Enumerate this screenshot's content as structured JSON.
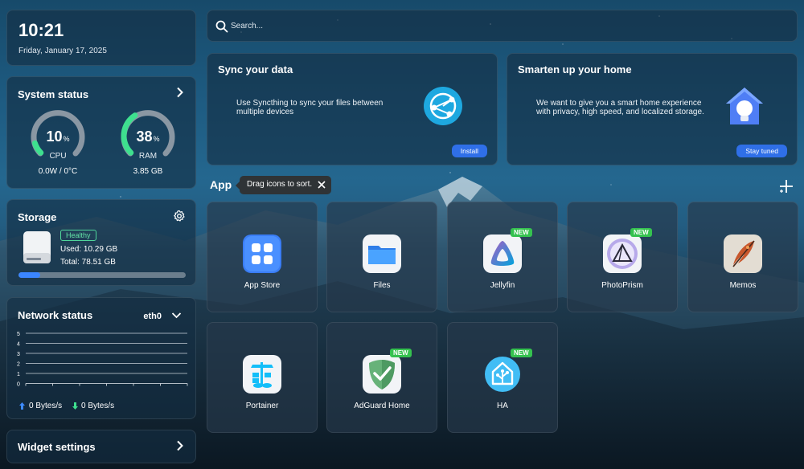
{
  "clock": {
    "time": "10:21",
    "date": "Friday, January 17, 2025"
  },
  "system_status": {
    "title": "System status",
    "cpu": {
      "value": "10",
      "unit": "%",
      "label": "CPU",
      "sub": "0.0W / 0°C",
      "percent": 10
    },
    "ram": {
      "value": "38",
      "unit": "%",
      "label": "RAM",
      "sub": "3.85 GB",
      "percent": 38
    }
  },
  "storage": {
    "title": "Storage",
    "health": "Healthy",
    "used": "Used: 10.29 GB",
    "total": "Total: 78.51 GB",
    "fraction_used": 0.131
  },
  "network": {
    "title": "Network status",
    "interface": "eth0",
    "y_ticks": [
      "5",
      "4",
      "3",
      "2",
      "1",
      "0"
    ],
    "upload": "0 Bytes/s",
    "download": "0 Bytes/s"
  },
  "widget_settings": {
    "label": "Widget settings"
  },
  "search": {
    "placeholder": "Search..."
  },
  "promos": {
    "sync": {
      "title": "Sync your data",
      "description": "Use Syncthing to sync your files between multiple devices",
      "button": "Install"
    },
    "home": {
      "title": "Smarten up your home",
      "description": "We want to give you a smart home experience with privacy, high speed, and localized storage.",
      "button": "Stay tuned"
    }
  },
  "apps": {
    "heading": "App",
    "tooltip": "Drag icons to sort.",
    "items": [
      {
        "name": "App Store",
        "icon": "app-store-icon",
        "new": ""
      },
      {
        "name": "Files",
        "icon": "folder-icon",
        "new": ""
      },
      {
        "name": "Jellyfin",
        "icon": "jellyfin-icon",
        "new": "NEW"
      },
      {
        "name": "PhotoPrism",
        "icon": "photoprism-icon",
        "new": "NEW"
      },
      {
        "name": "Memos",
        "icon": "memos-quill-icon",
        "new": ""
      },
      {
        "name": "Portainer",
        "icon": "portainer-icon",
        "new": ""
      },
      {
        "name": "AdGuard Home",
        "icon": "adguard-shield-icon",
        "new": "NEW"
      },
      {
        "name": "HA",
        "icon": "home-assistant-icon",
        "new": "NEW"
      }
    ]
  },
  "colors": {
    "accent": "#2f6fe8",
    "gauge_green": "#3ee08f",
    "new_badge": "#35c24f",
    "healthy": "#4fd59a"
  }
}
